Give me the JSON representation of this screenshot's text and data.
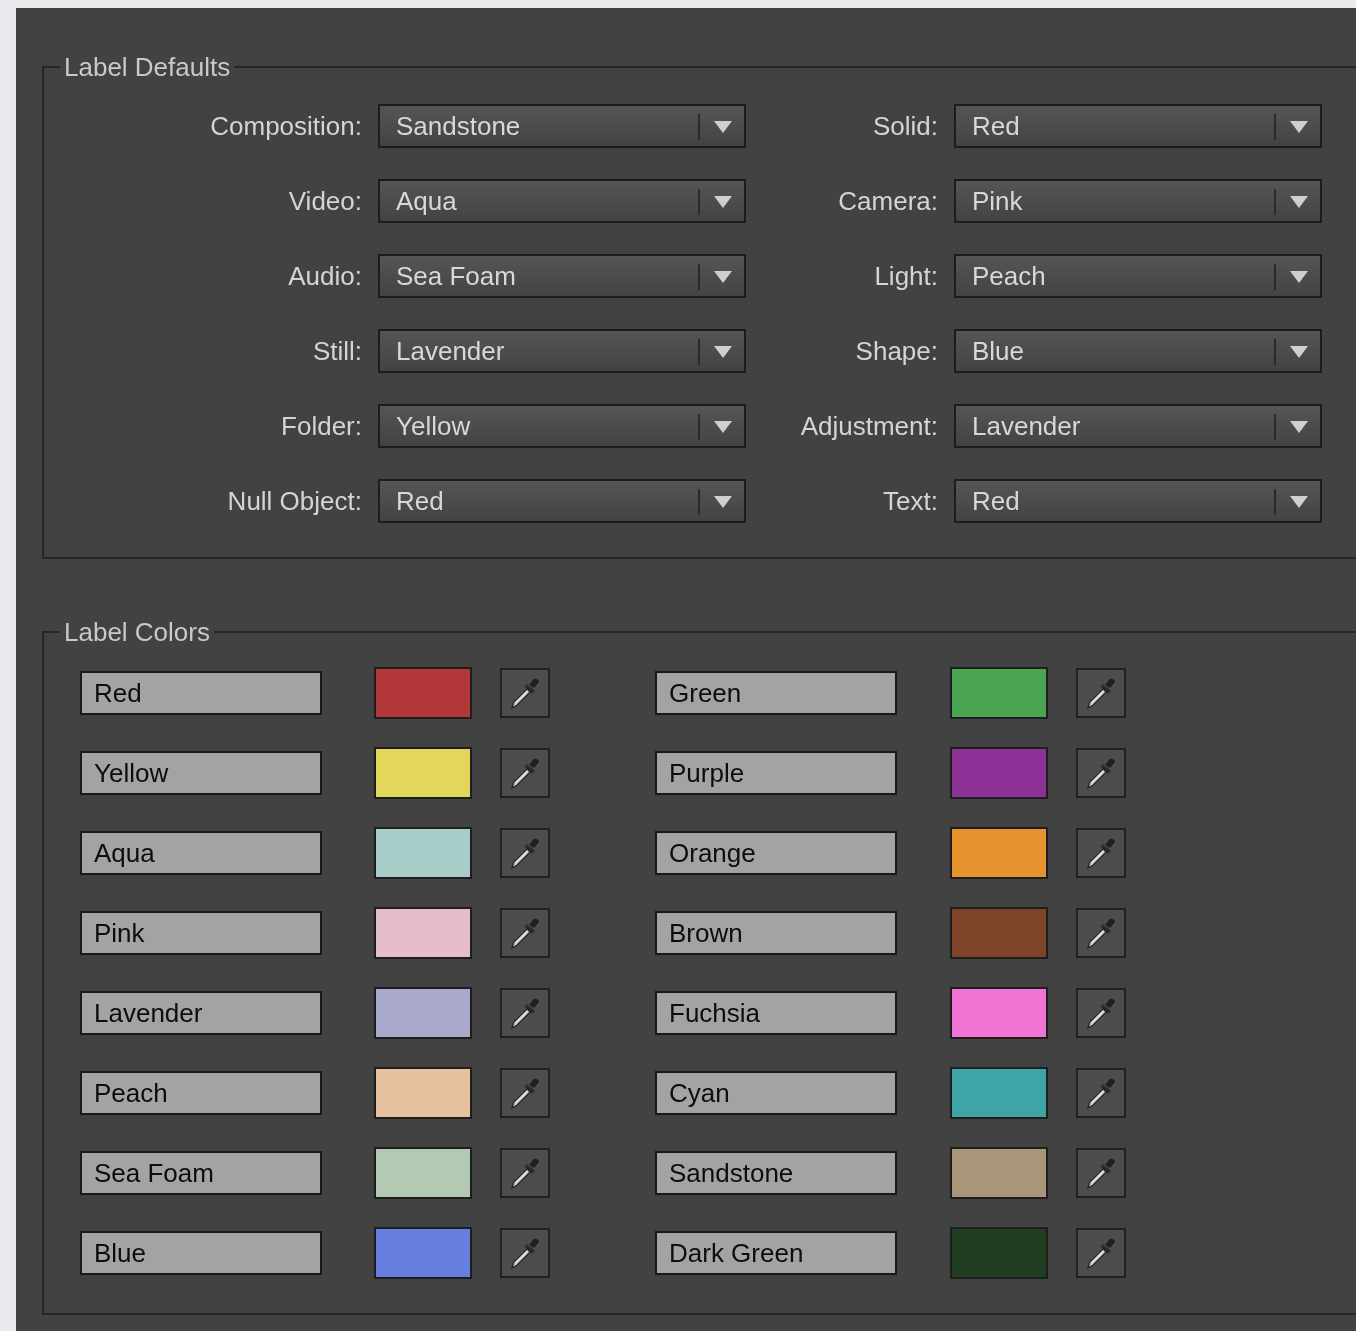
{
  "label_defaults": {
    "title": "Label Defaults",
    "fields": [
      {
        "label": "Composition:",
        "value": "Sandstone"
      },
      {
        "label": "Solid:",
        "value": "Red"
      },
      {
        "label": "Video:",
        "value": "Aqua"
      },
      {
        "label": "Camera:",
        "value": "Pink"
      },
      {
        "label": "Audio:",
        "value": "Sea Foam"
      },
      {
        "label": "Light:",
        "value": "Peach"
      },
      {
        "label": "Still:",
        "value": "Lavender"
      },
      {
        "label": "Shape:",
        "value": "Blue"
      },
      {
        "label": "Folder:",
        "value": "Yellow"
      },
      {
        "label": "Adjustment:",
        "value": "Lavender"
      },
      {
        "label": "Null Object:",
        "value": "Red"
      },
      {
        "label": "Text:",
        "value": "Red"
      }
    ]
  },
  "label_colors": {
    "title": "Label Colors",
    "items": [
      {
        "name": "Red",
        "color": "#b3383a"
      },
      {
        "name": "Green",
        "color": "#4aa552"
      },
      {
        "name": "Yellow",
        "color": "#e2d75a"
      },
      {
        "name": "Purple",
        "color": "#8c3296"
      },
      {
        "name": "Aqua",
        "color": "#a8cdc9"
      },
      {
        "name": "Orange",
        "color": "#e6922d"
      },
      {
        "name": "Pink",
        "color": "#e5bdcb"
      },
      {
        "name": "Brown",
        "color": "#7e442a"
      },
      {
        "name": "Lavender",
        "color": "#a9aacb"
      },
      {
        "name": "Fuchsia",
        "color": "#f174d4"
      },
      {
        "name": "Peach",
        "color": "#e5c19f"
      },
      {
        "name": "Cyan",
        "color": "#3ea4a6"
      },
      {
        "name": "Sea Foam",
        "color": "#b2c9b2"
      },
      {
        "name": "Sandstone",
        "color": "#a8957a"
      },
      {
        "name": "Blue",
        "color": "#677fe0"
      },
      {
        "name": "Dark Green",
        "color": "#1f3e20"
      }
    ]
  }
}
